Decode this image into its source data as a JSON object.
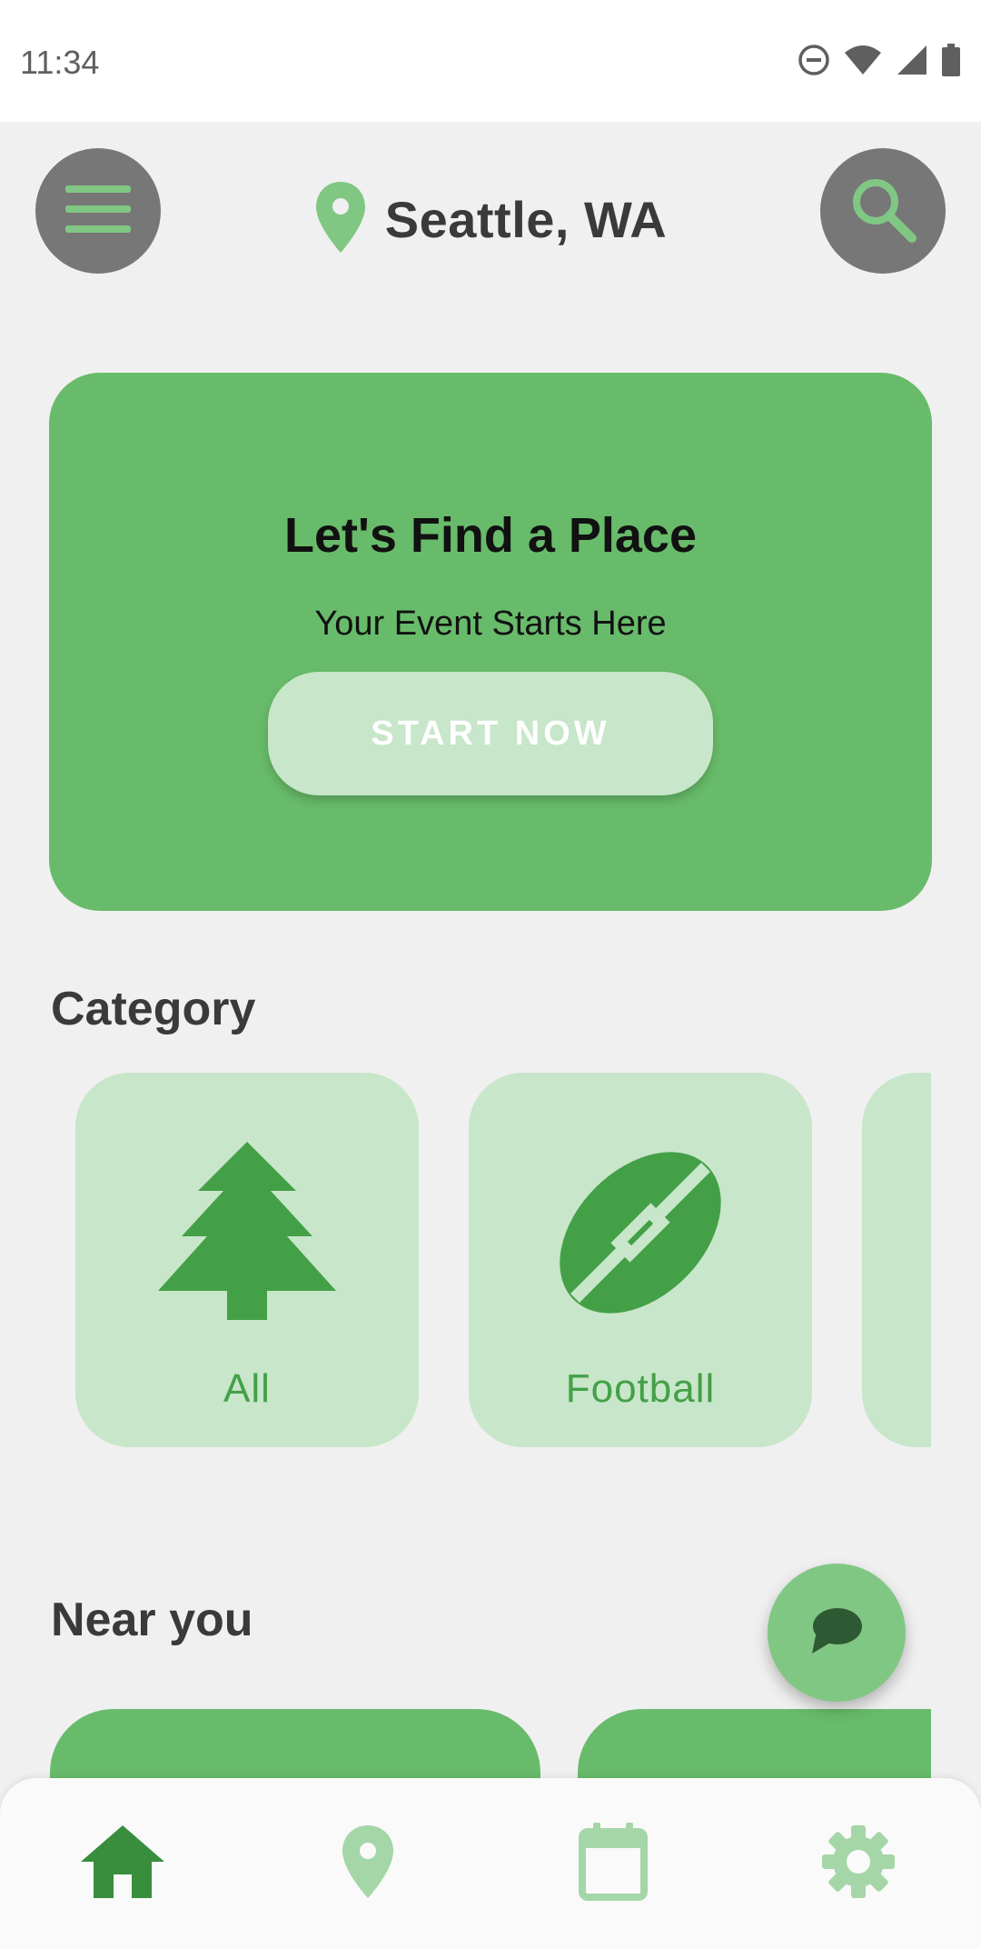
{
  "status_bar": {
    "time": "11:34",
    "icons": [
      "do-not-disturb-icon",
      "wifi-icon",
      "signal-icon",
      "battery-icon"
    ]
  },
  "header": {
    "menu_icon": "menu-icon",
    "location_icon": "location-pin-icon",
    "location": "Seattle, WA",
    "search_icon": "search-icon"
  },
  "hero": {
    "title": "Let's Find a Place",
    "subtitle": "Your Event Starts Here",
    "button_label": "START NOW"
  },
  "category": {
    "title": "Category",
    "items": [
      {
        "label": "All",
        "icon": "tree-icon"
      },
      {
        "label": "Football",
        "icon": "football-icon"
      }
    ]
  },
  "near_you": {
    "title": "Near you"
  },
  "fab": {
    "icon": "chat-icon"
  },
  "bottom_nav": {
    "items": [
      {
        "icon": "home-icon",
        "active": true
      },
      {
        "icon": "location-pin-icon",
        "active": false
      },
      {
        "icon": "calendar-icon",
        "active": false
      },
      {
        "icon": "gear-icon",
        "active": false
      }
    ]
  },
  "colors": {
    "accent": "#68bb6a",
    "accent_light": "#c8e6c9",
    "accent_dark": "#43a047",
    "nav_active": "#388e3c",
    "nav_inactive": "#a5d6a7",
    "button_gray": "#777777"
  }
}
